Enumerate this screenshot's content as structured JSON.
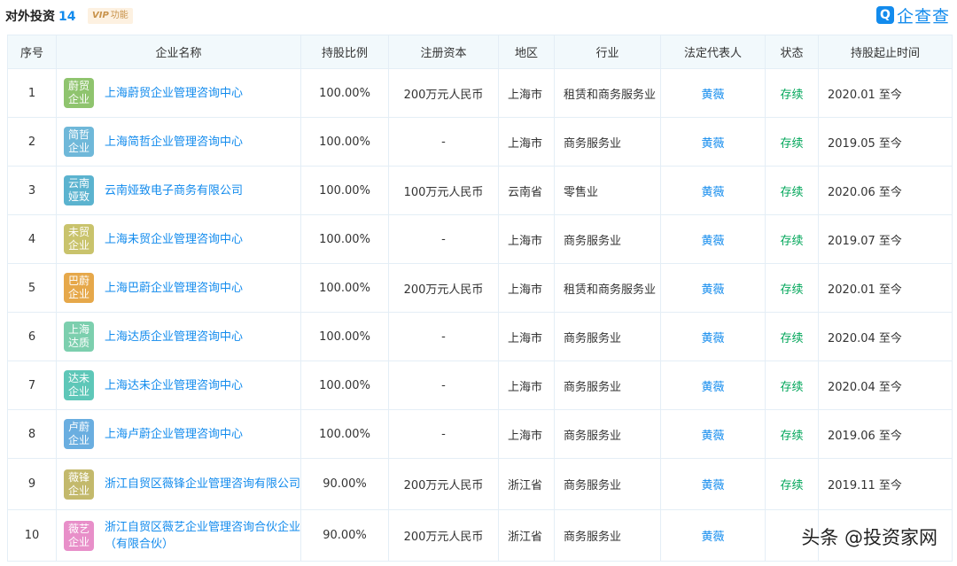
{
  "header": {
    "title": "对外投资",
    "count": "14",
    "vip_label": "VIP",
    "vip_suffix": "功能",
    "logo_mark": "Q",
    "logo_text": "企查查"
  },
  "table": {
    "columns": [
      "序号",
      "企业名称",
      "持股比例",
      "注册资本",
      "地区",
      "行业",
      "法定代表人",
      "状态",
      "持股起止时间"
    ],
    "rows": [
      {
        "no": "1",
        "avatar": "蔚贸企业",
        "avatar_color": "#8fc46e",
        "name": "上海蔚贸企业管理咨询中心",
        "ratio": "100.00%",
        "capital": "200万元人民币",
        "region": "上海市",
        "industry": "租赁和商务服务业",
        "rep": "黄薇",
        "status": "存续",
        "period": "2020.01 至今"
      },
      {
        "no": "2",
        "avatar": "简哲企业",
        "avatar_color": "#6fb8d9",
        "name": "上海简哲企业管理咨询中心",
        "ratio": "100.00%",
        "capital": "-",
        "region": "上海市",
        "industry": "商务服务业",
        "rep": "黄薇",
        "status": "存续",
        "period": "2019.05 至今"
      },
      {
        "no": "3",
        "avatar": "云南娅致",
        "avatar_color": "#5bb3cf",
        "name": "云南娅致电子商务有限公司",
        "ratio": "100.00%",
        "capital": "100万元人民币",
        "region": "云南省",
        "industry": "零售业",
        "rep": "黄薇",
        "status": "存续",
        "period": "2020.06 至今"
      },
      {
        "no": "4",
        "avatar": "未贸企业",
        "avatar_color": "#c9c36c",
        "name": "上海未贸企业管理咨询中心",
        "ratio": "100.00%",
        "capital": "-",
        "region": "上海市",
        "industry": "商务服务业",
        "rep": "黄薇",
        "status": "存续",
        "period": "2019.07 至今"
      },
      {
        "no": "5",
        "avatar": "巴蔚企业",
        "avatar_color": "#e6a84a",
        "name": "上海巴蔚企业管理咨询中心",
        "ratio": "100.00%",
        "capital": "200万元人民币",
        "region": "上海市",
        "industry": "租赁和商务服务业",
        "rep": "黄薇",
        "status": "存续",
        "period": "2020.01 至今"
      },
      {
        "no": "6",
        "avatar": "上海达质",
        "avatar_color": "#7ccfae",
        "name": "上海达质企业管理咨询中心",
        "ratio": "100.00%",
        "capital": "-",
        "region": "上海市",
        "industry": "商务服务业",
        "rep": "黄薇",
        "status": "存续",
        "period": "2020.04 至今"
      },
      {
        "no": "7",
        "avatar": "达未企业",
        "avatar_color": "#5ec7b8",
        "name": "上海达未企业管理咨询中心",
        "ratio": "100.00%",
        "capital": "-",
        "region": "上海市",
        "industry": "商务服务业",
        "rep": "黄薇",
        "status": "存续",
        "period": "2020.04 至今"
      },
      {
        "no": "8",
        "avatar": "卢蔚企业",
        "avatar_color": "#6aaee0",
        "name": "上海卢蔚企业管理咨询中心",
        "ratio": "100.00%",
        "capital": "-",
        "region": "上海市",
        "industry": "商务服务业",
        "rep": "黄薇",
        "status": "存续",
        "period": "2019.06 至今"
      },
      {
        "no": "9",
        "avatar": "薇锋企业",
        "avatar_color": "#c3b96c",
        "name": "浙江自贸区薇锋企业管理咨询有限公司",
        "ratio": "90.00%",
        "capital": "200万元人民币",
        "region": "浙江省",
        "industry": "商务服务业",
        "rep": "黄薇",
        "status": "存续",
        "period": "2019.11 至今"
      },
      {
        "no": "10",
        "avatar": "薇艺企业",
        "avatar_color": "#e88fc9",
        "name": "浙江自贸区薇艺企业管理咨询合伙企业（有限合伙）",
        "ratio": "90.00%",
        "capital": "200万元人民币",
        "region": "浙江省",
        "industry": "商务服务业",
        "rep": "黄薇",
        "status": "",
        "period": ""
      }
    ]
  },
  "watermark": "头条 @投资家网"
}
